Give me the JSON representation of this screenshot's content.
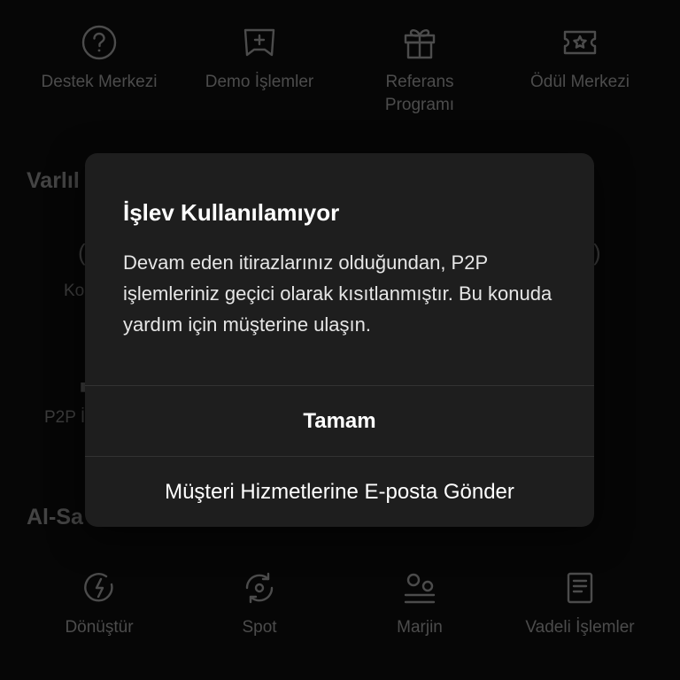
{
  "top_row": [
    {
      "label": "Destek Merkezi",
      "icon": "help-circle-icon"
    },
    {
      "label": "Demo İşlemler",
      "icon": "gamepad-icon"
    },
    {
      "label": "Referans\nProgramı",
      "icon": "gift-icon"
    },
    {
      "label": "Ödül Merkezi",
      "icon": "ticket-star-icon"
    }
  ],
  "sections": {
    "assets_title_partial": "Varlıl",
    "trade_title_partial": "Al-Sa"
  },
  "partial_texts": {
    "left_row1": "Ko",
    "left_row2": "P2P İ"
  },
  "bottom_row": [
    {
      "label": "Dönüştür",
      "icon": "convert-icon"
    },
    {
      "label": "Spot",
      "icon": "spot-icon"
    },
    {
      "label": "Marjin",
      "icon": "margin-icon"
    },
    {
      "label": "Vadeli İşlemler",
      "icon": "futures-icon"
    }
  ],
  "dialog": {
    "title": "İşlev Kullanılamıyor",
    "message": "Devam eden itirazlarınız olduğundan, P2P işlemleriniz geçici olarak kısıtlanmıştır. Bu konuda yardım için müşterine ulaşın.",
    "ok_label": "Tamam",
    "email_label": "Müşteri Hizmetlerine E-posta Gönder"
  },
  "colors": {
    "background": "#0b0b0b",
    "dialog_bg": "#1e1e1e",
    "muted_text": "#8a8a8a",
    "primary_text": "#ffffff"
  }
}
